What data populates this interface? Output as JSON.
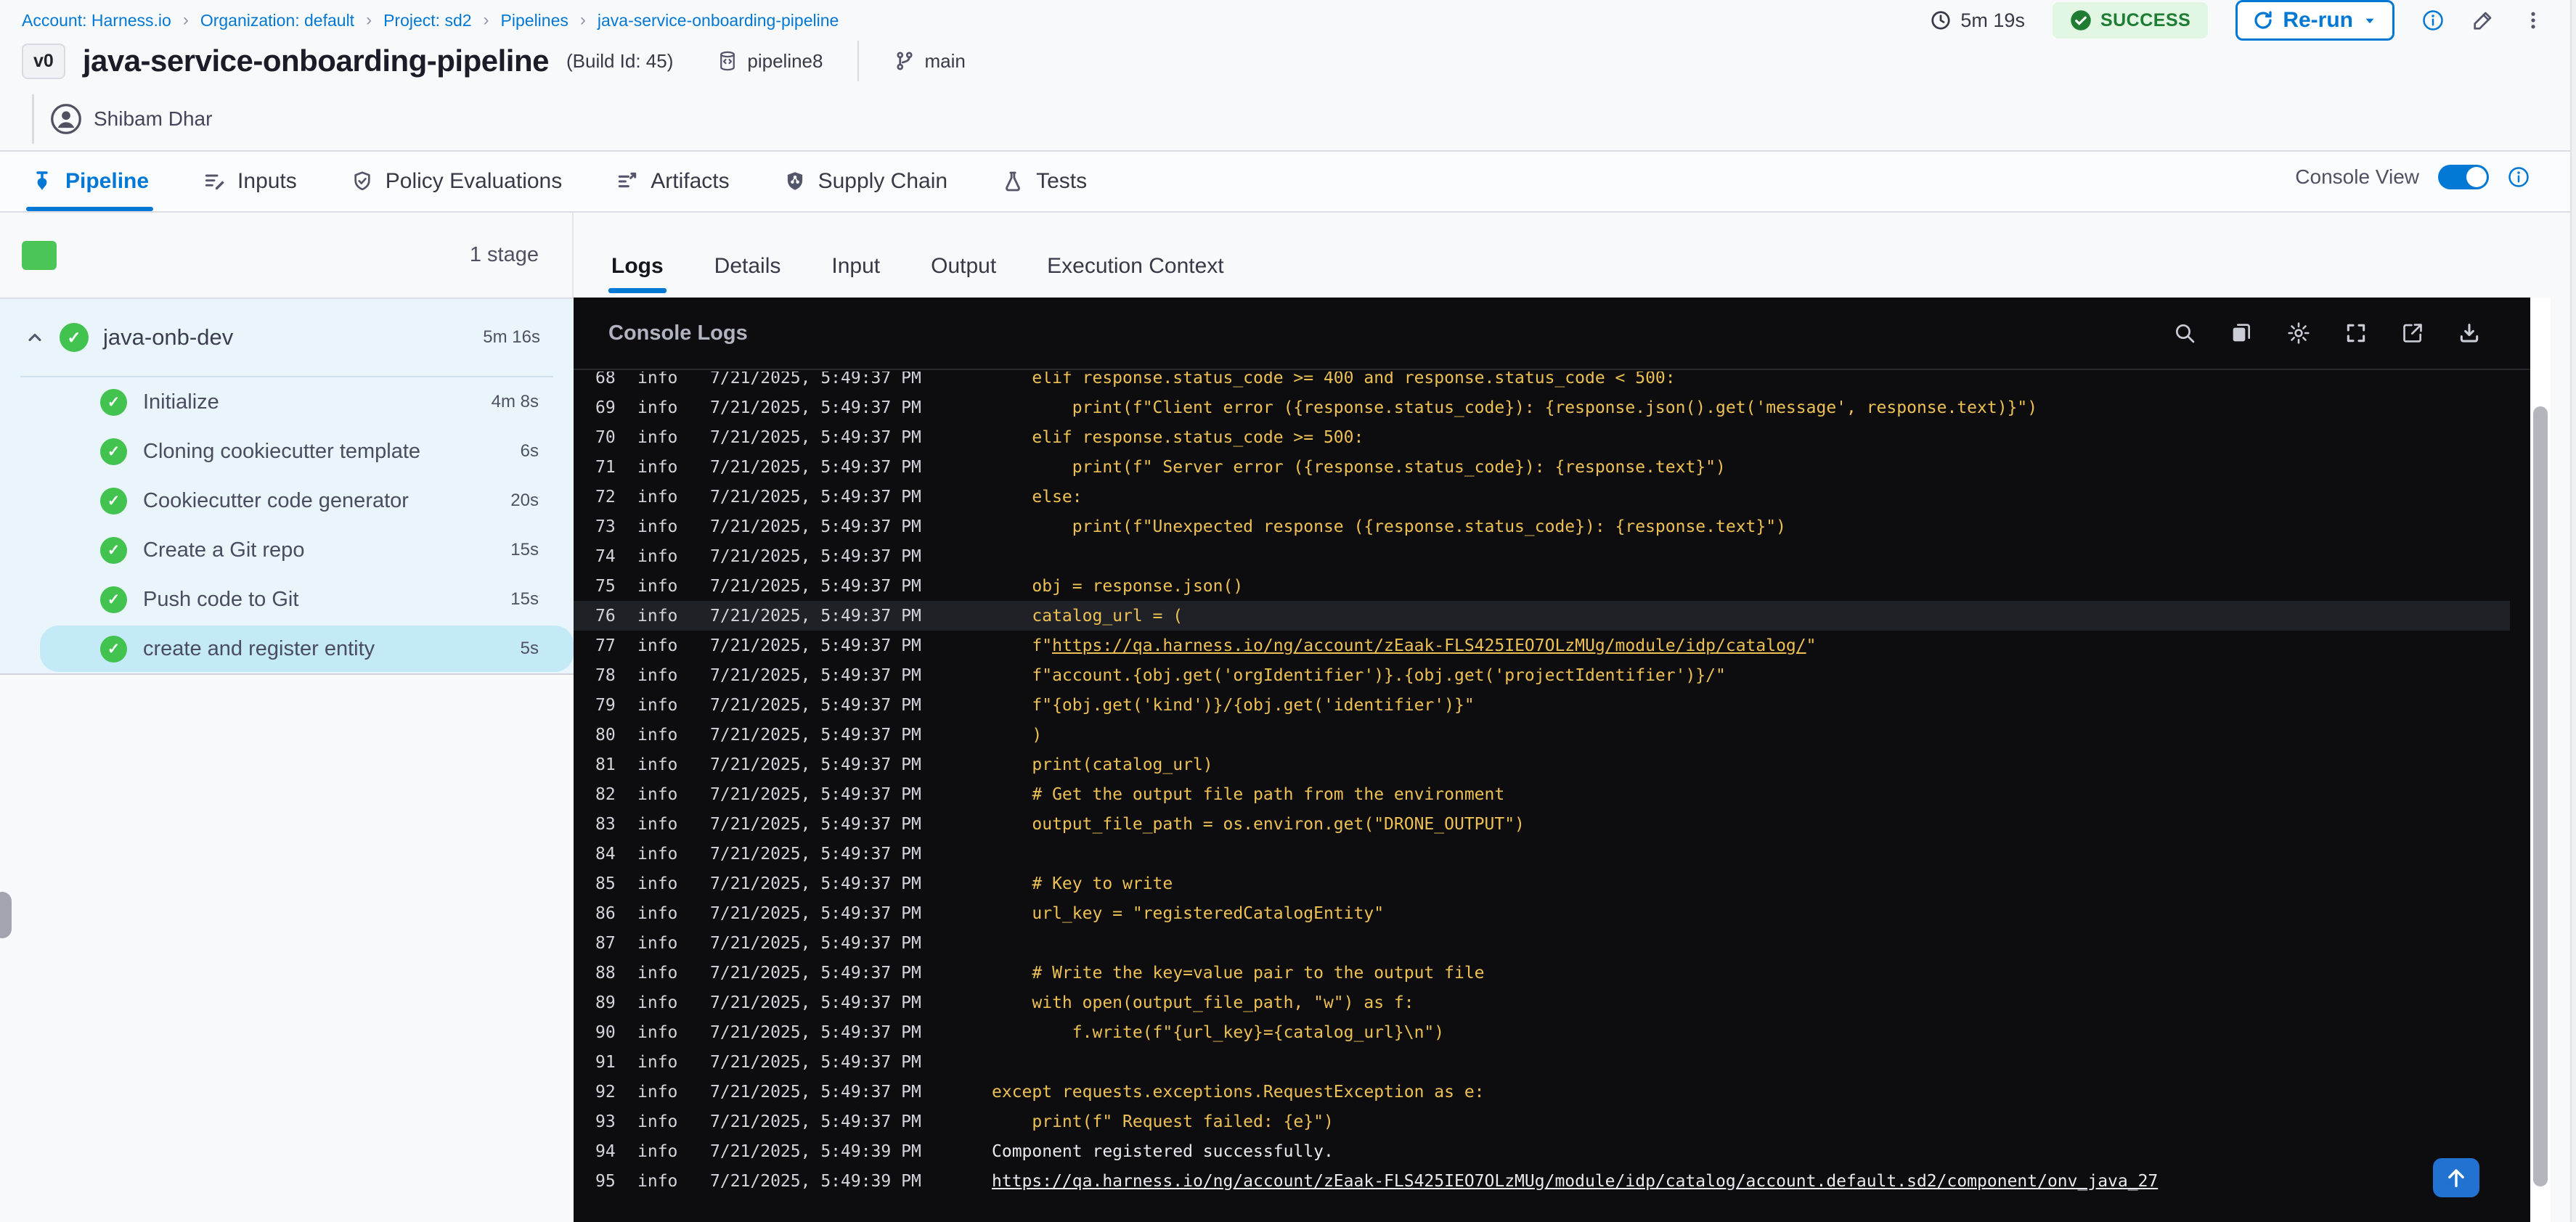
{
  "breadcrumb": {
    "separator": "›",
    "items": [
      "Account: Harness.io",
      "Organization: default",
      "Project: sd2",
      "Pipelines",
      "java-service-onboarding-pipeline"
    ]
  },
  "topbar": {
    "duration": "5m 19s",
    "status": "SUCCESS",
    "rerun_label": "Re-run"
  },
  "header": {
    "version_badge": "v0",
    "title": "java-service-onboarding-pipeline",
    "build_id": "(Build Id: 45)",
    "pipeline_tag": "pipeline8",
    "branch": "main",
    "author": "Shibam Dhar"
  },
  "nav_tabs": [
    {
      "label": "Pipeline",
      "icon": "pipeline-icon",
      "active": true
    },
    {
      "label": "Inputs",
      "icon": "inputs-icon",
      "active": false
    },
    {
      "label": "Policy Evaluations",
      "icon": "policy-icon",
      "active": false
    },
    {
      "label": "Artifacts",
      "icon": "artifacts-icon",
      "active": false
    },
    {
      "label": "Supply Chain",
      "icon": "supply-chain-icon",
      "active": false
    },
    {
      "label": "Tests",
      "icon": "tests-icon",
      "active": false
    }
  ],
  "console_view": {
    "label": "Console View",
    "enabled": true
  },
  "sidebar": {
    "stage_count": "1 stage",
    "stage": {
      "name": "java-onb-dev",
      "duration": "5m 16s"
    },
    "steps": [
      {
        "name": "Initialize",
        "duration": "4m 8s",
        "selected": false
      },
      {
        "name": "Cloning cookiecutter template",
        "duration": "6s",
        "selected": false
      },
      {
        "name": "Cookiecutter code generator",
        "duration": "20s",
        "selected": false
      },
      {
        "name": "Create a Git repo",
        "duration": "15s",
        "selected": false
      },
      {
        "name": "Push code to Git",
        "duration": "15s",
        "selected": false
      },
      {
        "name": "create and register entity",
        "duration": "5s",
        "selected": true
      }
    ]
  },
  "log_panel": {
    "tabs": [
      {
        "label": "Logs",
        "active": true
      },
      {
        "label": "Details",
        "active": false
      },
      {
        "label": "Input",
        "active": false
      },
      {
        "label": "Output",
        "active": false
      },
      {
        "label": "Execution Context",
        "active": false
      }
    ],
    "console_title": "Console Logs",
    "toolbar_icons": [
      "search-icon",
      "copy-icon",
      "settings-icon",
      "fullscreen-icon",
      "open-new-tab-icon",
      "download-icon"
    ]
  },
  "colors": {
    "accent": "#0278d5",
    "success_green": "#42c24f",
    "badge_green_bg": "#e2f6e4",
    "badge_green_text": "#1c7d33",
    "console_bg": "#0d0d10",
    "log_yellow": "#edc053",
    "log_white": "#e9e9f0",
    "selected_step_bg": "#c5eaf7"
  },
  "logs": {
    "level": "info",
    "lines": [
      {
        "n": 68,
        "ts": "7/21/2025, 5:49:37 PM",
        "color": "yellow",
        "text": "    elif response.status_code >= 400 and response.status_code < 500:"
      },
      {
        "n": 69,
        "ts": "7/21/2025, 5:49:37 PM",
        "color": "yellow",
        "text": "        print(f\"Client error ({response.status_code}): {response.json().get('message', response.text)}\")"
      },
      {
        "n": 70,
        "ts": "7/21/2025, 5:49:37 PM",
        "color": "yellow",
        "text": "    elif response.status_code >= 500:"
      },
      {
        "n": 71,
        "ts": "7/21/2025, 5:49:37 PM",
        "color": "yellow",
        "text": "        print(f\" Server error ({response.status_code}): {response.text}\")"
      },
      {
        "n": 72,
        "ts": "7/21/2025, 5:49:37 PM",
        "color": "yellow",
        "text": "    else:"
      },
      {
        "n": 73,
        "ts": "7/21/2025, 5:49:37 PM",
        "color": "yellow",
        "text": "        print(f\"Unexpected response ({response.status_code}): {response.text}\")"
      },
      {
        "n": 74,
        "ts": "7/21/2025, 5:49:37 PM",
        "color": "yellow",
        "text": ""
      },
      {
        "n": 75,
        "ts": "7/21/2025, 5:49:37 PM",
        "color": "yellow",
        "text": "    obj = response.json()"
      },
      {
        "n": 76,
        "ts": "7/21/2025, 5:49:37 PM",
        "color": "yellow",
        "text": "    catalog_url = (",
        "highlight": true
      },
      {
        "n": 77,
        "ts": "7/21/2025, 5:49:37 PM",
        "color": "yellow",
        "parts": [
          {
            "t": "    f\""
          },
          {
            "t": "https://qa.harness.io/ng/account/zEaak-FLS425IEO7OLzMUg/module/idp/catalog/",
            "link": true
          },
          {
            "t": "\""
          }
        ]
      },
      {
        "n": 78,
        "ts": "7/21/2025, 5:49:37 PM",
        "color": "yellow",
        "text": "    f\"account.{obj.get('orgIdentifier')}.{obj.get('projectIdentifier')}/\""
      },
      {
        "n": 79,
        "ts": "7/21/2025, 5:49:37 PM",
        "color": "yellow",
        "text": "    f\"{obj.get('kind')}/{obj.get('identifier')}\""
      },
      {
        "n": 80,
        "ts": "7/21/2025, 5:49:37 PM",
        "color": "yellow",
        "text": "    )"
      },
      {
        "n": 81,
        "ts": "7/21/2025, 5:49:37 PM",
        "color": "yellow",
        "text": "    print(catalog_url)"
      },
      {
        "n": 82,
        "ts": "7/21/2025, 5:49:37 PM",
        "color": "yellow",
        "text": "    # Get the output file path from the environment"
      },
      {
        "n": 83,
        "ts": "7/21/2025, 5:49:37 PM",
        "color": "yellow",
        "text": "    output_file_path = os.environ.get(\"DRONE_OUTPUT\")"
      },
      {
        "n": 84,
        "ts": "7/21/2025, 5:49:37 PM",
        "color": "yellow",
        "text": ""
      },
      {
        "n": 85,
        "ts": "7/21/2025, 5:49:37 PM",
        "color": "yellow",
        "text": "    # Key to write"
      },
      {
        "n": 86,
        "ts": "7/21/2025, 5:49:37 PM",
        "color": "yellow",
        "text": "    url_key = \"registeredCatalogEntity\""
      },
      {
        "n": 87,
        "ts": "7/21/2025, 5:49:37 PM",
        "color": "yellow",
        "text": ""
      },
      {
        "n": 88,
        "ts": "7/21/2025, 5:49:37 PM",
        "color": "yellow",
        "text": "    # Write the key=value pair to the output file"
      },
      {
        "n": 89,
        "ts": "7/21/2025, 5:49:37 PM",
        "color": "yellow",
        "text": "    with open(output_file_path, \"w\") as f:"
      },
      {
        "n": 90,
        "ts": "7/21/2025, 5:49:37 PM",
        "color": "yellow",
        "text": "        f.write(f\"{url_key}={catalog_url}\\n\")"
      },
      {
        "n": 91,
        "ts": "7/21/2025, 5:49:37 PM",
        "color": "yellow",
        "text": ""
      },
      {
        "n": 92,
        "ts": "7/21/2025, 5:49:37 PM",
        "color": "yellow",
        "text": "except requests.exceptions.RequestException as e:"
      },
      {
        "n": 93,
        "ts": "7/21/2025, 5:49:37 PM",
        "color": "yellow",
        "text": "    print(f\" Request failed: {e}\")"
      },
      {
        "n": 94,
        "ts": "7/21/2025, 5:49:39 PM",
        "color": "white",
        "text": "Component registered successfully."
      },
      {
        "n": 95,
        "ts": "7/21/2025, 5:49:39 PM",
        "color": "white",
        "parts": [
          {
            "t": "https://qa.harness.io/ng/account/zEaak-FLS425IEO7OLzMUg/module/idp/catalog/account.default.sd2/component/onv_java_27",
            "link": true
          }
        ]
      }
    ]
  }
}
